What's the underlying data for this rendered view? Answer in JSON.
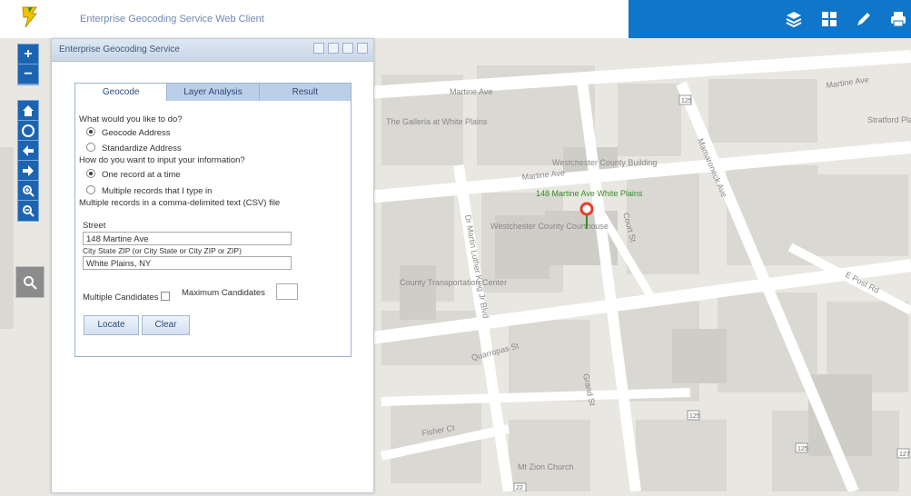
{
  "app": {
    "title": "Enterprise Geocoding Service Web Client"
  },
  "panel": {
    "title": "Enterprise Geocoding Service",
    "tabs": [
      "Geocode",
      "Layer Analysis",
      "Result"
    ],
    "question1": "What would you like to do?",
    "opt_geocode": "Geocode Address",
    "opt_standardize": "Standardize Address",
    "question2": "How do you want to input your information?",
    "opt_one_record": "One record at a time",
    "opt_multiple_typed": "Multiple records that I type in",
    "opt_csv": "Multiple records in a comma-delimited text (CSV) file",
    "street_label": "Street",
    "street_value": "148 Martine Ave",
    "city_label": "City State ZIP (or City State or City ZIP or ZIP)",
    "city_value": "White Plains, NY",
    "multi_candidates_label": "Multiple Candidates",
    "max_candidates_label": "Maximum Candidates",
    "max_candidates_value": "",
    "locate_label": "Locate",
    "clear_label": "Clear"
  },
  "map": {
    "labels": {
      "martine_top": "Martine Ave",
      "martine_mid": "Martine Ave",
      "martine_right": "Martine Ave",
      "galleria": "The Galleria at White Plains",
      "westchester_county": "Westchester County Building",
      "county_courthouse": "Westchester County Courthouse",
      "county_center": "County Transportation Center",
      "mlk": "Dr Martin Luther King Jr Blvd",
      "mamaroneck": "Mamaroneck Ave",
      "court": "Court St",
      "post": "E Post Rd",
      "quarropas": "Quarropas St",
      "grand": "Grand St",
      "fisher": "Fisher Ct",
      "mt_zion": "Mt Zion Church",
      "church_right": "Stratford Place",
      "result": "148 Martine Ave White Plains"
    },
    "shields": [
      "125",
      "125",
      "22",
      "125",
      "127"
    ],
    "marker_color": "#e53e2e"
  },
  "colors": {
    "accent": "#0f76c9",
    "control": "#1c64b1"
  }
}
